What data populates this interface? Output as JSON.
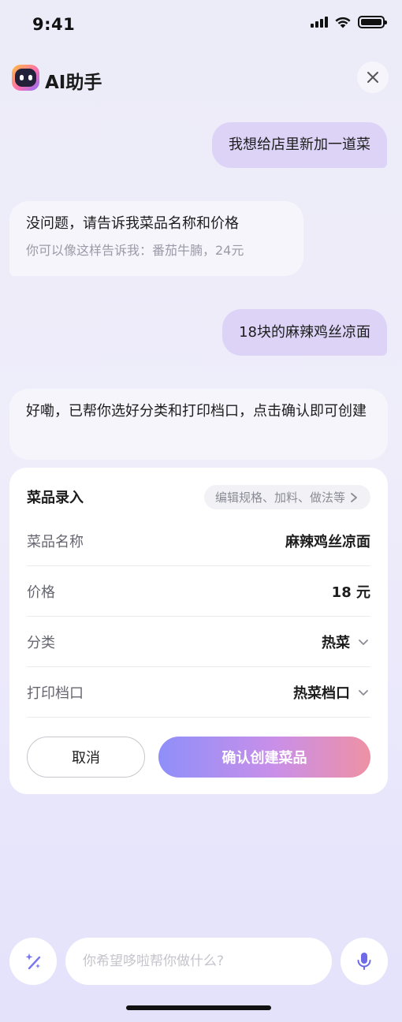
{
  "status": {
    "time": "9:41"
  },
  "header": {
    "title": "AI助手"
  },
  "chat": {
    "user_msg_1": "我想给店里新加一道菜",
    "ai_msg_1": "没问题，请告诉我菜品名称和价格",
    "ai_msg_1_hint": "你可以像这样告诉我：番茄牛腩，24元",
    "user_msg_2": "18块的麻辣鸡丝凉面",
    "ai_msg_2": "好嘞，已帮你选好分类和打印档口，点击确认即可创建"
  },
  "card": {
    "title": "菜品录入",
    "chip": "编辑规格、加料、做法等",
    "rows": [
      {
        "label": "菜品名称",
        "value": "麻辣鸡丝凉面"
      },
      {
        "label": "价格",
        "value": "18 元"
      },
      {
        "label": "分类",
        "value": "热菜"
      },
      {
        "label": "打印档口",
        "value": "热菜档口"
      }
    ],
    "cancel": "取消",
    "confirm": "确认创建菜品"
  },
  "input": {
    "placeholder": "你希望哆啦帮你做什么?"
  },
  "colors": {
    "accent_start": "#8f8ff9",
    "accent_end": "#ee91a4",
    "user_bubble": "#ddd3f7"
  },
  "icons": [
    "signal-icon",
    "wifi-icon",
    "battery-icon",
    "app-logo-icon",
    "close-icon",
    "chevron-right-icon",
    "chevron-down-icon",
    "magic-wand-icon",
    "microphone-icon"
  ]
}
